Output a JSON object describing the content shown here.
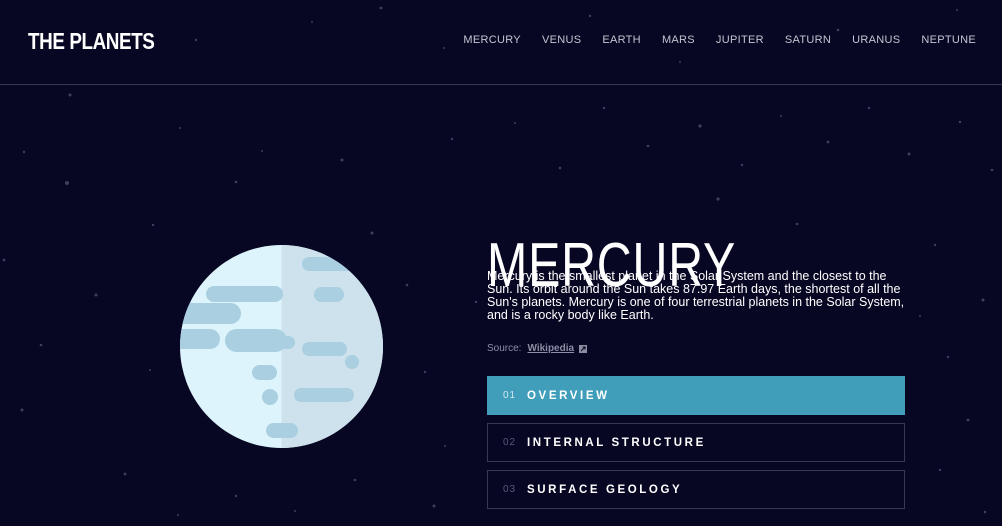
{
  "header": {
    "logo": "THE PLANETS",
    "nav": [
      "MERCURY",
      "VENUS",
      "EARTH",
      "MARS",
      "JUPITER",
      "SATURN",
      "URANUS",
      "NEPTUNE"
    ]
  },
  "planet": {
    "name": "MERCURY",
    "image_icon": "mercury-planet-illustration",
    "description": "Mercury is the smallest planet in the Solar System and the closest to the Sun. Its orbit around the Sun takes 87.97 Earth days, the shortest of all the Sun's planets. Mercury is one of four terrestrial planets in the Solar System, and is a rocky body like Earth.",
    "source_label": "Source:",
    "source_link": "Wikipedia",
    "source_icon": "external-link-icon"
  },
  "tabs": [
    {
      "num": "01",
      "label": "OVERVIEW",
      "active": true
    },
    {
      "num": "02",
      "label": "INTERNAL STRUCTURE",
      "active": false
    },
    {
      "num": "03",
      "label": "SURFACE GEOLOGY",
      "active": false
    }
  ],
  "colors": {
    "background": "#070724",
    "active_tab": "#419ebb",
    "border": "#38384f",
    "planet_light": "#def4fc",
    "planet_dark": "#cde2ec",
    "planet_spots": "#a9cfe0"
  }
}
